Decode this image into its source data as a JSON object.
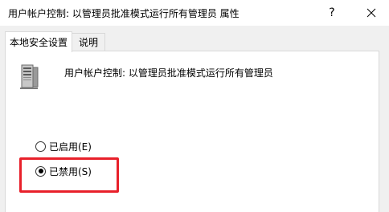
{
  "window": {
    "title": "用户帐户控制: 以管理员批准模式运行所有管理员 属性",
    "help_glyph": "?",
    "close_icon": "close-icon"
  },
  "tabs": [
    {
      "label": "本地安全设置",
      "active": true
    },
    {
      "label": "说明",
      "active": false
    }
  ],
  "policy": {
    "icon": "server-policy-icon",
    "name": "用户帐户控制: 以管理员批准模式运行所有管理员"
  },
  "options": [
    {
      "label": "已启用(E)",
      "checked": false
    },
    {
      "label": "已禁用(S)",
      "checked": true
    }
  ],
  "annotation": {
    "highlight_color": "#e8202a"
  }
}
